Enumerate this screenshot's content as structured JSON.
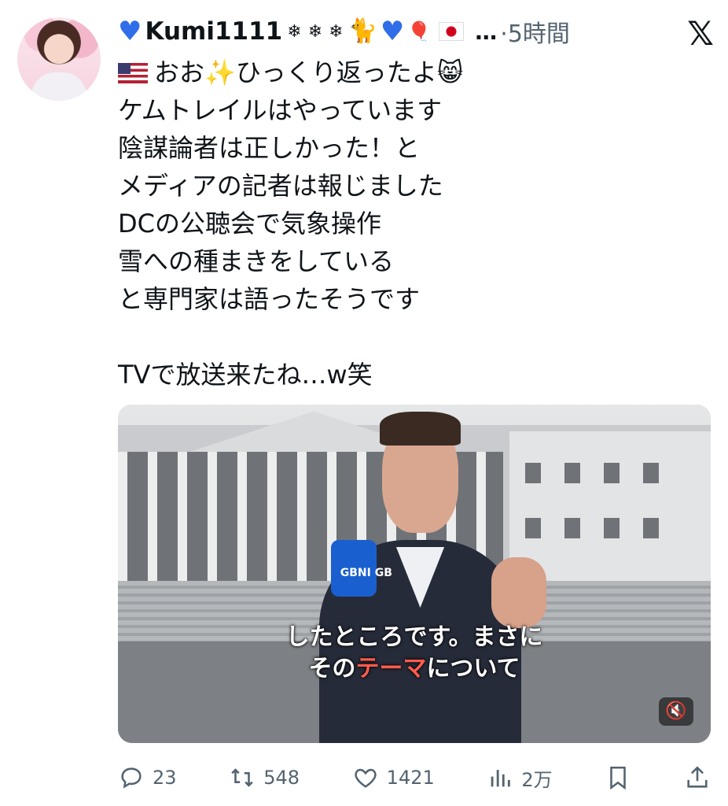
{
  "post": {
    "author": {
      "display_name": "Kumi1111",
      "badges": [
        "blue-heart",
        "snowflake",
        "snowflake",
        "snowflake",
        "black-cat",
        "blue-heart",
        "balloon",
        "flag-jp"
      ],
      "ellipsis": "…",
      "time": "5時間"
    },
    "platform_icon": "x-logo",
    "text": {
      "line1": "おお✨ひっくり返ったよ😸",
      "line2": "ケムトレイルはやっています",
      "line3": "陰謀論者は正しかった！と",
      "line4": "メディアの記者は報じました",
      "line5": "DCの公聴会で気象操作",
      "line6": "雪への種まきをしている",
      "line7": "と専門家は語ったそうです",
      "line8": "TVで放送来たね…w笑"
    },
    "media": {
      "subtitle_line1": "したところです。まさに",
      "subtitle_line2_a": "その",
      "subtitle_line2_highlight": "テーマ",
      "subtitle_line2_b": "について",
      "mic_label": "GBNI GB",
      "mute_icon": "mute-icon"
    },
    "actions": {
      "replies": "23",
      "reposts": "548",
      "likes": "1421",
      "views": "2万"
    }
  },
  "colors": {
    "heart_blue": "#2f6ee8",
    "muted_text": "#536471",
    "subtitle_highlight": "#ff5b4d"
  }
}
